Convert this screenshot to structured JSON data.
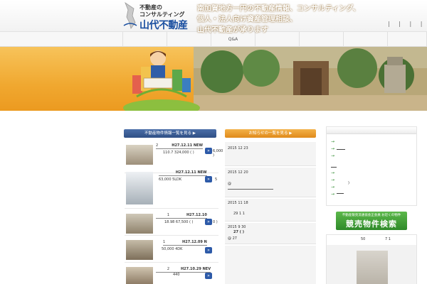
{
  "header": {
    "logo_line1": "不動産の",
    "logo_line2": "コンサルティング",
    "logo_line3": "山代不動産",
    "util_links": "|  |  |  |"
  },
  "nav": {
    "items": [
      {
        "label": ""
      },
      {
        "label": ""
      },
      {
        "label": "Q&A"
      },
      {
        "label": ""
      },
      {
        "label": ""
      },
      {
        "label": ""
      },
      {
        "label": ""
      }
    ]
  },
  "hero": {
    "line1": "南加賀地方一円の不動産情報、コンサルティング、",
    "line2": "個人・法人向け資産管理相談、",
    "line3": "山代不動産が承ります"
  },
  "properties": {
    "heading": "不動産物件情報一覧を見る ▶",
    "items": [
      {
        "title_a": "2",
        "title_b": "H27.12.11 NEW",
        "meta": "110.7        324,000    (   )",
        "mark": "6,000 )"
      },
      {
        "title_a": "",
        "title_b": "H27.12.11 NEW",
        "meta": "63,000    5LDK",
        "mark": "5"
      },
      {
        "title_a": "1",
        "title_b": "H27.12.10",
        "meta": "18.98        67,500    (   )",
        "mark": "0 )"
      },
      {
        "title_a": "1",
        "title_b": "H27.12.09 N",
        "meta": "50,000    4DK",
        "mark": ""
      },
      {
        "title_a": "2",
        "title_b": "H27.10.29 NEV",
        "meta": "440",
        "mark": ""
      }
    ]
  },
  "news": {
    "heading": "お知らせの一覧を見る ▶",
    "items": [
      {
        "date": "2015   12   23",
        "sub": ""
      },
      {
        "date": "2015   12   20",
        "sub": "@"
      },
      {
        "date": "2015   11   18",
        "sub": "29    1    1"
      },
      {
        "date": "2015   9   30",
        "sub": "27                       (     )"
      },
      {
        "date": "",
        "sub": "@                27"
      }
    ]
  },
  "sidebar": {
    "items": [
      {
        "label": "→"
      },
      {
        "label": "→"
      },
      {
        "label": "→"
      },
      {
        "label": "→"
      },
      {
        "label": "→"
      },
      {
        "label": "→"
      },
      {
        "label": "→"
      }
    ],
    "extra_1": ")",
    "banner_top": "不動産競売流通協会正会員 お近くの物件",
    "banner_main": "競売物件検索",
    "low_text_a": "50",
    "low_text_b": "7   1"
  }
}
